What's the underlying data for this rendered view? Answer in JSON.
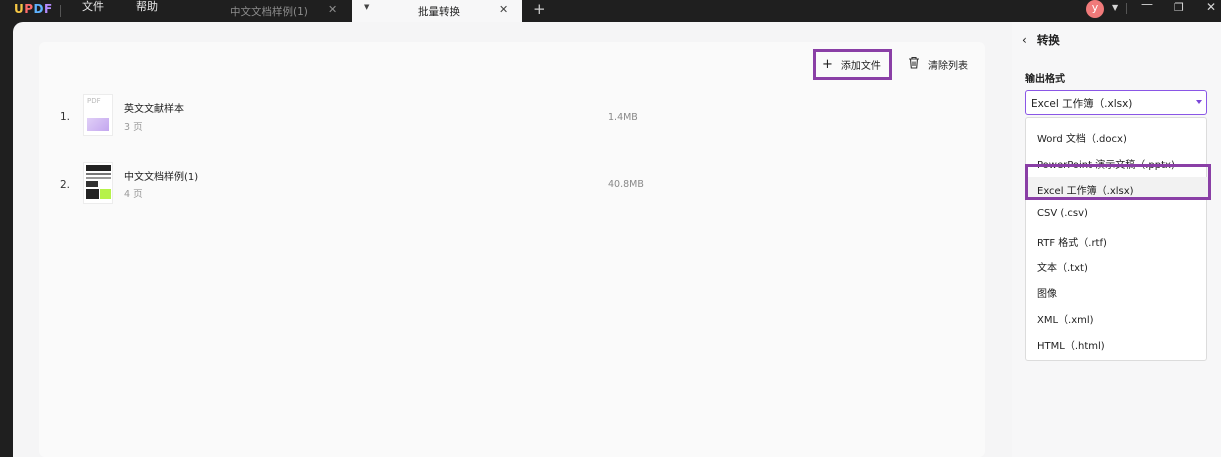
{
  "app": {
    "logo": {
      "u": "U",
      "p": "P",
      "d": "D",
      "f": "F"
    }
  },
  "menu": [
    "文件",
    "帮助"
  ],
  "tabs": [
    {
      "label": "中文文档样例(1)",
      "active": false
    },
    {
      "label": "批量转换",
      "active": true
    }
  ],
  "avatar": "y",
  "toolbar": {
    "add_files": "添加文件",
    "clear_list": "清除列表"
  },
  "files": [
    {
      "index": "1.",
      "name": "英文文献样本",
      "pages": "3 页",
      "size": "1.4MB",
      "thumb_label": "PDF"
    },
    {
      "index": "2.",
      "name": "中文文档样例(1)",
      "pages": "4 页",
      "size": "40.8MB"
    }
  ],
  "side": {
    "title": "转换",
    "output_format_label": "输出格式",
    "selected": "Excel 工作簿（.xlsx)",
    "options": [
      "Word 文档（.docx)",
      "PowerPoint 演示文稿（.pptx)",
      "Excel 工作簿（.xlsx)",
      "CSV (.csv)",
      "RTF 格式（.rtf)",
      "文本（.txt)",
      "图像",
      "XML（.xml)",
      "HTML（.html)"
    ]
  },
  "colors": {
    "highlight": "#8a3fa6",
    "accent": "#8a56e6"
  }
}
